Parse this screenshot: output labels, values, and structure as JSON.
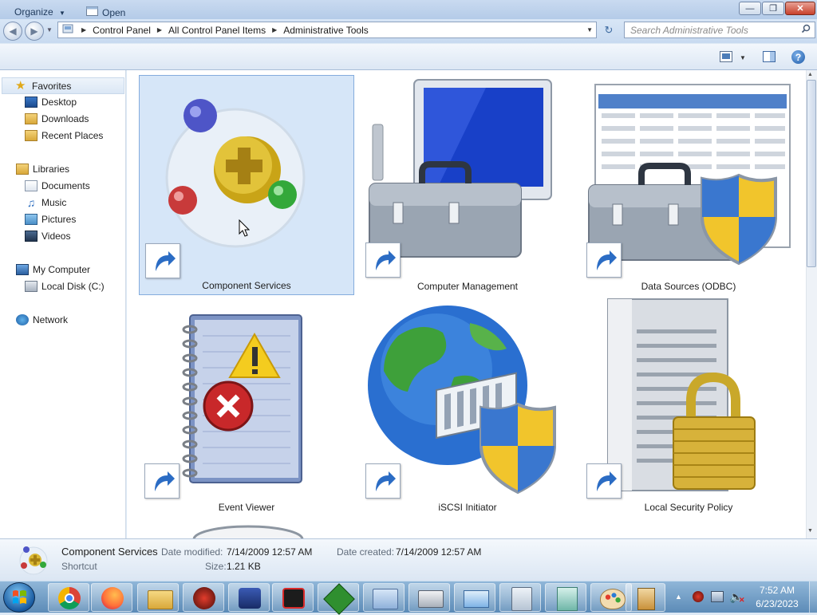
{
  "window": {
    "minimize_label": "—",
    "maximize_label": "❐",
    "close_label": "✕"
  },
  "address_bar": {
    "breadcrumbs": [
      "Control Panel",
      "All Control Panel Items",
      "Administrative Tools"
    ],
    "search_placeholder": "Search Administrative Tools"
  },
  "toolbar": {
    "organize_label": "Organize",
    "open_label": "Open"
  },
  "sidebar": {
    "favorites": {
      "label": "Favorites",
      "items": [
        "Desktop",
        "Downloads",
        "Recent Places"
      ]
    },
    "libraries": {
      "label": "Libraries",
      "items": [
        "Documents",
        "Music",
        "Pictures",
        "Videos"
      ]
    },
    "computer": {
      "label": "My Computer",
      "items": [
        "Local Disk (C:)"
      ]
    },
    "network": {
      "label": "Network"
    }
  },
  "items": [
    {
      "label": "Component Services",
      "icon": "component-services-icon",
      "selected": true
    },
    {
      "label": "Computer Management",
      "icon": "computer-management-icon"
    },
    {
      "label": "Data Sources (ODBC)",
      "icon": "data-sources-icon"
    },
    {
      "label": "Event Viewer",
      "icon": "event-viewer-icon"
    },
    {
      "label": "iSCSI Initiator",
      "icon": "iscsi-initiator-icon"
    },
    {
      "label": "Local Security Policy",
      "icon": "local-security-policy-icon"
    }
  ],
  "details": {
    "name": "Component Services",
    "type": "Shortcut",
    "modified_label": "Date modified:",
    "modified_value": "7/14/2009 12:57 AM",
    "created_label": "Date created:",
    "created_value": "7/14/2009 12:57 AM",
    "size_label": "Size:",
    "size_value": "1.21 KB"
  },
  "taskbar": {
    "apps": [
      "chrome-icon",
      "firefox-icon",
      "explorer-icon",
      "red-app-icon",
      "remote-desktop-icon",
      "screen-recorder-icon",
      "vim-icon",
      "control-panel-icon",
      "fax-printer-icon",
      "mail-icon",
      "calculator-icon",
      "notepad-icon",
      "paint-icon",
      "tools-icon"
    ],
    "time": "7:52 AM",
    "date": "6/23/2023"
  },
  "colors": {
    "selection": "#d6e6f8",
    "selection_border": "#84acdd",
    "taskbar": "#5c8bb7"
  }
}
